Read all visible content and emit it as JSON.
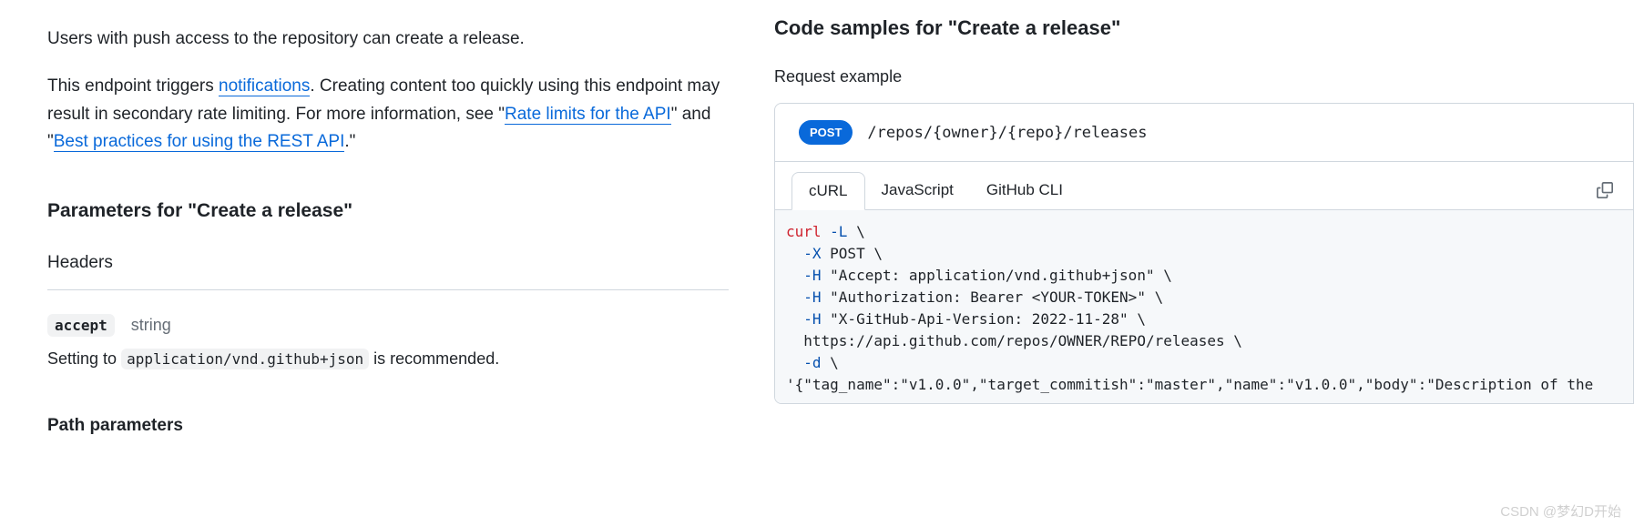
{
  "left": {
    "intro": "Users with push access to the repository can create a release.",
    "para2_pre": "This endpoint triggers ",
    "link_notifications": "notifications",
    "para2_mid": ". Creating content too quickly using this endpoint may result in secondary rate limiting. For more information, see \"",
    "link_rate": "Rate limits for the API",
    "para2_mid2": "\" and \"",
    "link_best": "Best practices for using the REST API",
    "para2_end": ".\"",
    "params_heading": "Parameters for \"Create a release\"",
    "headers_heading": "Headers",
    "accept_name": "accept",
    "accept_type": "string",
    "accept_desc_pre": "Setting to ",
    "accept_code": "application/vnd.github+json",
    "accept_desc_post": " is recommended.",
    "path_params_heading": "Path parameters"
  },
  "right": {
    "heading": "Code samples for \"Create a release\"",
    "request_heading": "Request example",
    "method": "POST",
    "path": "/repos/{owner}/{repo}/releases",
    "tabs": {
      "curl": "cURL",
      "js": "JavaScript",
      "cli": "GitHub CLI"
    },
    "code": {
      "cmd": "curl",
      "l1_flag": " -L",
      "l1_rest": " \\",
      "l2_flag": "  -X",
      "l2_rest": " POST \\",
      "l3_flag": "  -H",
      "l3_rest": " \"Accept: application/vnd.github+json\" \\",
      "l4_flag": "  -H",
      "l4_rest": " \"Authorization: Bearer <YOUR-TOKEN>\" \\",
      "l5_flag": "  -H",
      "l5_rest": " \"X-GitHub-Api-Version: 2022-11-28\" \\",
      "l6": "  https://api.github.com/repos/OWNER/REPO/releases \\",
      "l7_flag": "  -d",
      "l7_rest": " \\",
      "l8": "'{\"tag_name\":\"v1.0.0\",\"target_commitish\":\"master\",\"name\":\"v1.0.0\",\"body\":\"Description of the"
    }
  },
  "watermark": "CSDN @梦幻D开始"
}
